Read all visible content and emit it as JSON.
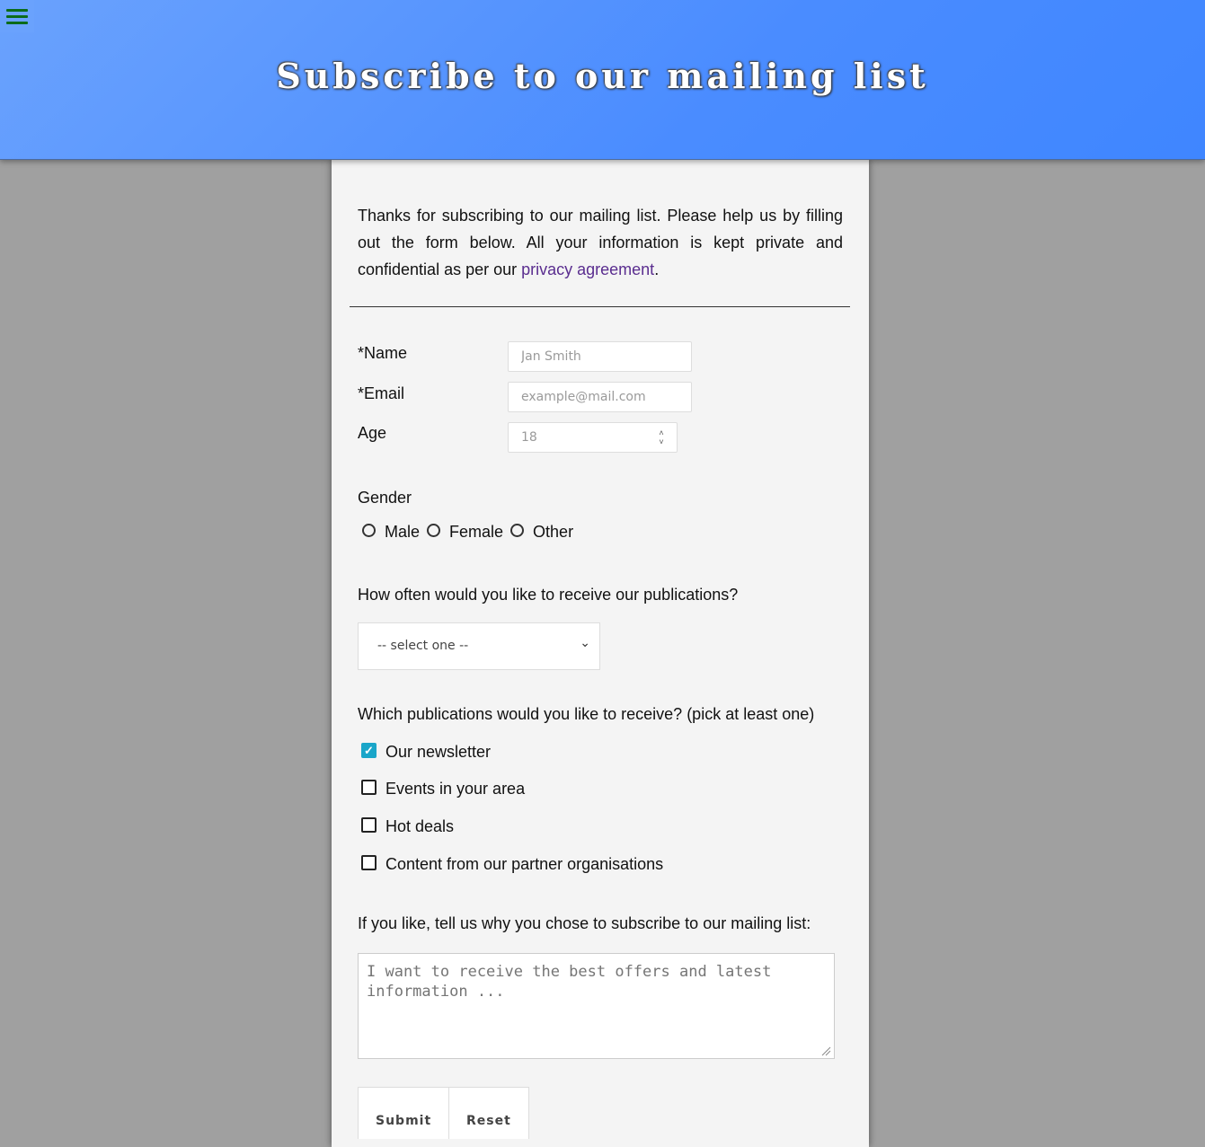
{
  "header": {
    "title": "Subscribe to our mailing list",
    "menu_icon": "hamburger-menu-icon",
    "menu_color": "#0b6b1a"
  },
  "intro": {
    "text_before": "Thanks for subscribing to our mailing list. Please help us by filling out the form below. All your information is kept private and confidential as per our ",
    "link": "privacy agreement",
    "text_after": "."
  },
  "form": {
    "name_label": "*Name",
    "name_placeholder": "Jan Smith",
    "email_label": "*Email",
    "email_placeholder": "example@mail.com",
    "age_label": "Age",
    "age_placeholder": "18",
    "gender_label": "Gender",
    "gender_options": [
      "Male",
      "Female",
      "Other"
    ],
    "frequency_label": "How often would you like to receive our publications?",
    "frequency_selected": "-- select one --",
    "publications_label": "Which publications would you like to receive? (pick at least one)",
    "publications": [
      {
        "label": "Our newsletter",
        "checked": true
      },
      {
        "label": "Events in your area",
        "checked": false
      },
      {
        "label": "Hot deals",
        "checked": false
      },
      {
        "label": "Content from our partner organisations",
        "checked": false
      }
    ],
    "reason_label": "If you like, tell us why you chose to subscribe to our mailing list:",
    "reason_placeholder": "I want to receive the best offers and latest information ...",
    "submit_label": "Submit",
    "reset_label": "Reset"
  },
  "colors": {
    "header_gradient_start": "#6aa2fd",
    "header_gradient_end": "#3f86ff",
    "link": "#5a2d8f",
    "checkbox_checked": "#1aa6c9",
    "page_background": "#a0a0a0",
    "panel_background": "#f4f4f4"
  }
}
